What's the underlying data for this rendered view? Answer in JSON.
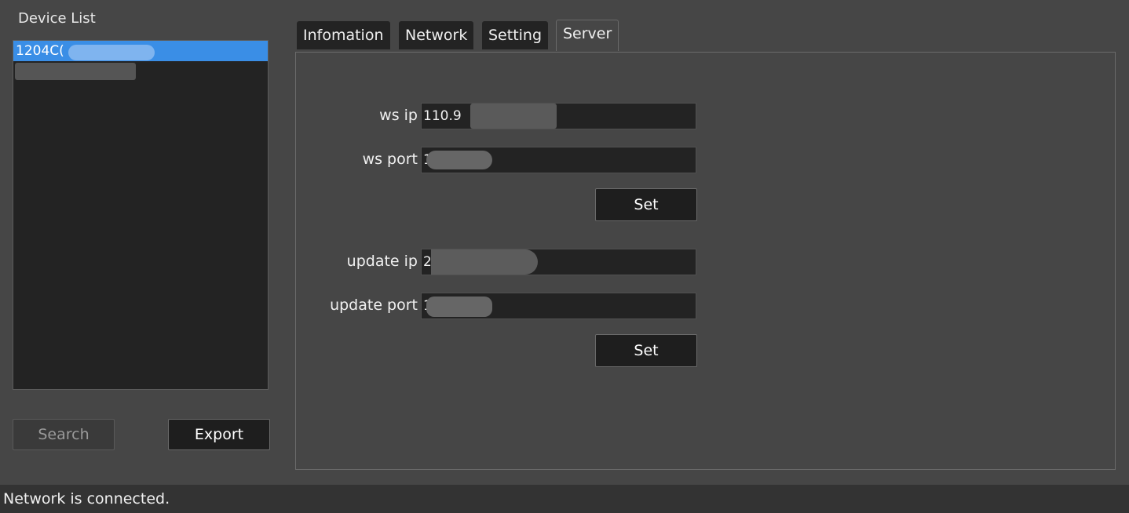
{
  "device_list": {
    "title": "Device List",
    "items": [
      {
        "label": "1204C(",
        "selected": true
      },
      {
        "label": "",
        "selected": false
      }
    ]
  },
  "buttons": {
    "search": "Search",
    "export": "Export"
  },
  "tabs": [
    {
      "label": "Infomation",
      "active": false
    },
    {
      "label": "Network",
      "active": false
    },
    {
      "label": "Setting",
      "active": false
    },
    {
      "label": "Server",
      "active": true
    }
  ],
  "server": {
    "ws_ip_label": "ws ip",
    "ws_ip_value": "110.9",
    "ws_port_label": "ws port",
    "ws_port_value": "1",
    "ws_set": "Set",
    "update_ip_label": "update ip",
    "update_ip_value": "2",
    "update_port_label": "update port",
    "update_port_value": "1",
    "update_set": "Set"
  },
  "status": {
    "text": "Network is connected."
  },
  "colors": {
    "background": "#464646",
    "list_background": "#232323",
    "selection": "#3a8ee6",
    "status_bar": "#333333"
  }
}
